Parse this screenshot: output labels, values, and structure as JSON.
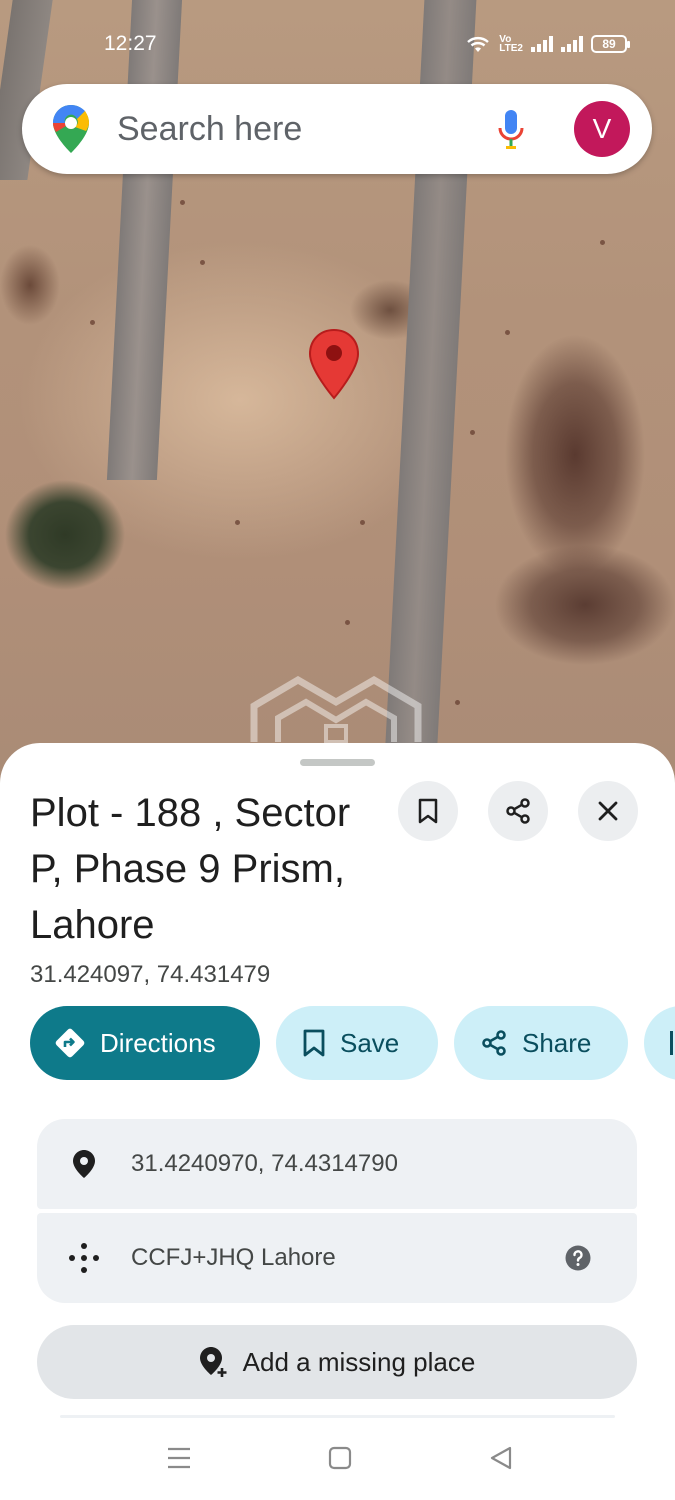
{
  "status_bar": {
    "time": "12:27",
    "volte_label": "Vo\nLTE2",
    "battery": "89"
  },
  "search": {
    "placeholder": "Search here",
    "avatar_initial": "V"
  },
  "place": {
    "title": "Plot - 188 , Sector P, Phase 9 Prism, Lahore",
    "coordinates": "31.424097, 74.431479"
  },
  "actions": {
    "directions": "Directions",
    "save": "Save",
    "share": "Share"
  },
  "details": {
    "coordinates_precise": "31.4240970, 74.4314790",
    "plus_code": "CCFJ+JHQ Lahore"
  },
  "add_place_label": "Add a missing place",
  "colors": {
    "primary_chip": "#0e7a8a",
    "secondary_chip": "#cdeff8",
    "avatar": "#c2185b",
    "pin": "#e53935"
  }
}
